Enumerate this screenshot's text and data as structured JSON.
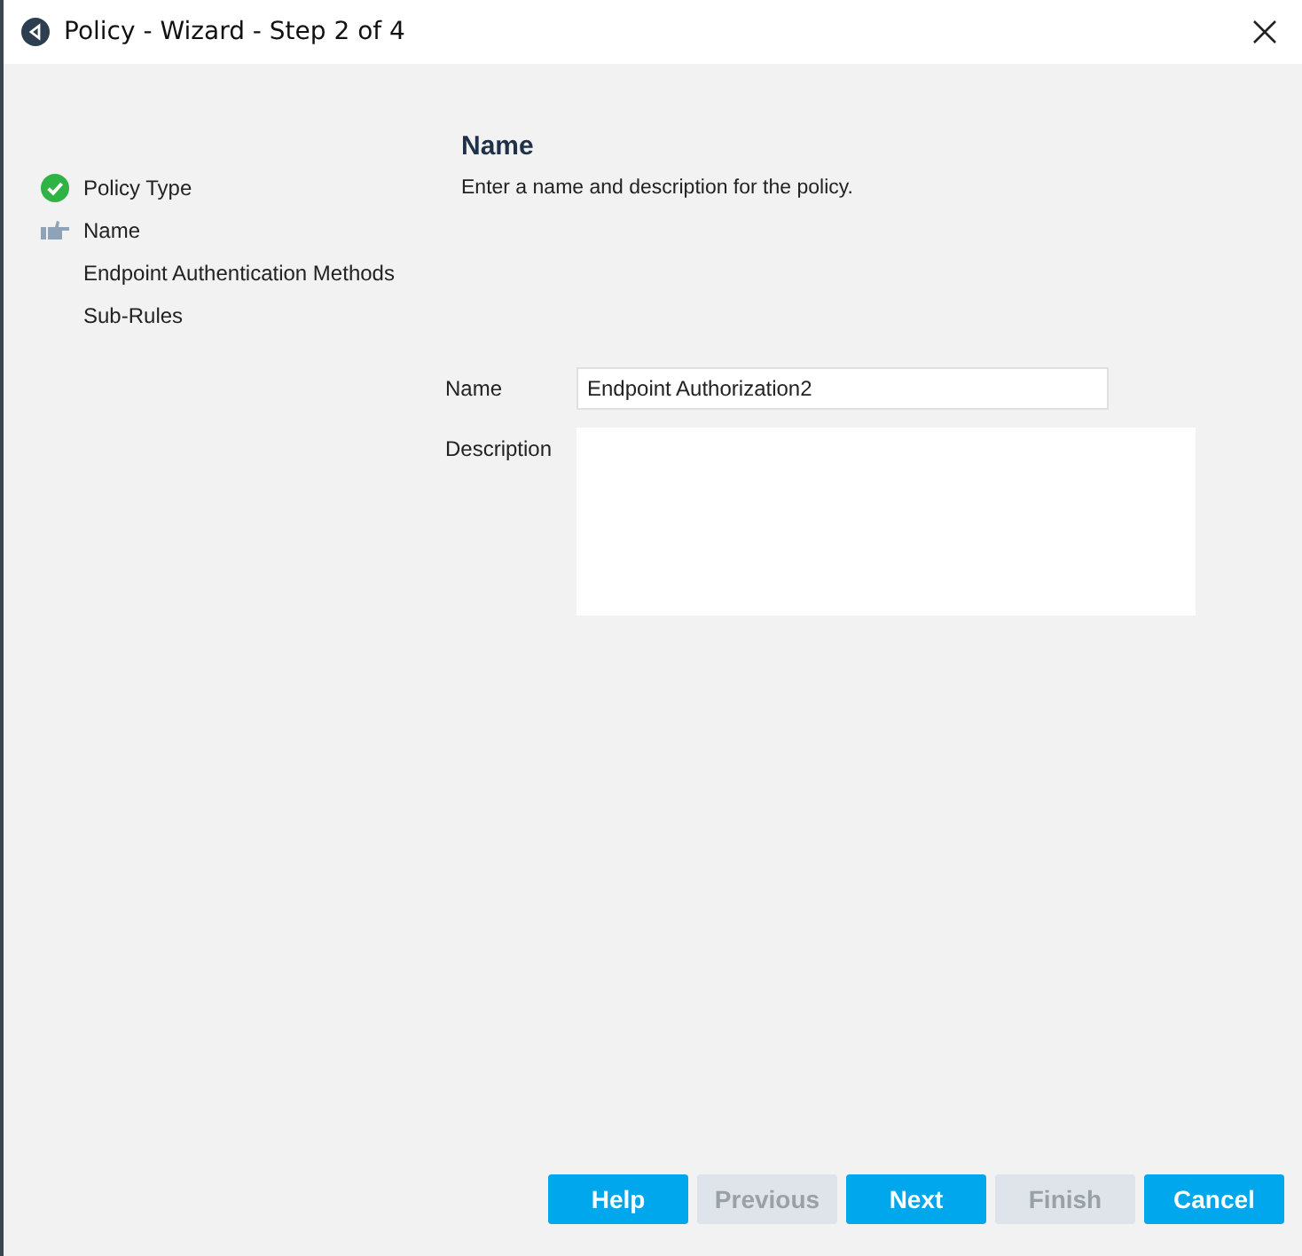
{
  "window": {
    "title": "Policy - Wizard - Step 2 of 4"
  },
  "steps": [
    {
      "label": "Policy Type",
      "completed": true,
      "selected": false
    },
    {
      "label": "Name",
      "completed": false,
      "selected": true
    },
    {
      "label": "Endpoint Authentication Methods",
      "completed": false,
      "selected": false
    },
    {
      "label": "Sub-Rules",
      "completed": false,
      "selected": false
    }
  ],
  "page": {
    "heading": "Name",
    "instruction": "Enter a name and description for the policy."
  },
  "form": {
    "name_label": "Name",
    "name_value": "Endpoint Authorization2",
    "description_label": "Description"
  },
  "buttons": [
    {
      "label": "Help",
      "disabled": false
    },
    {
      "label": "Previous",
      "disabled": true
    },
    {
      "label": "Next",
      "disabled": false
    },
    {
      "label": "Finish",
      "disabled": true
    },
    {
      "label": "Cancel",
      "disabled": false
    }
  ]
}
